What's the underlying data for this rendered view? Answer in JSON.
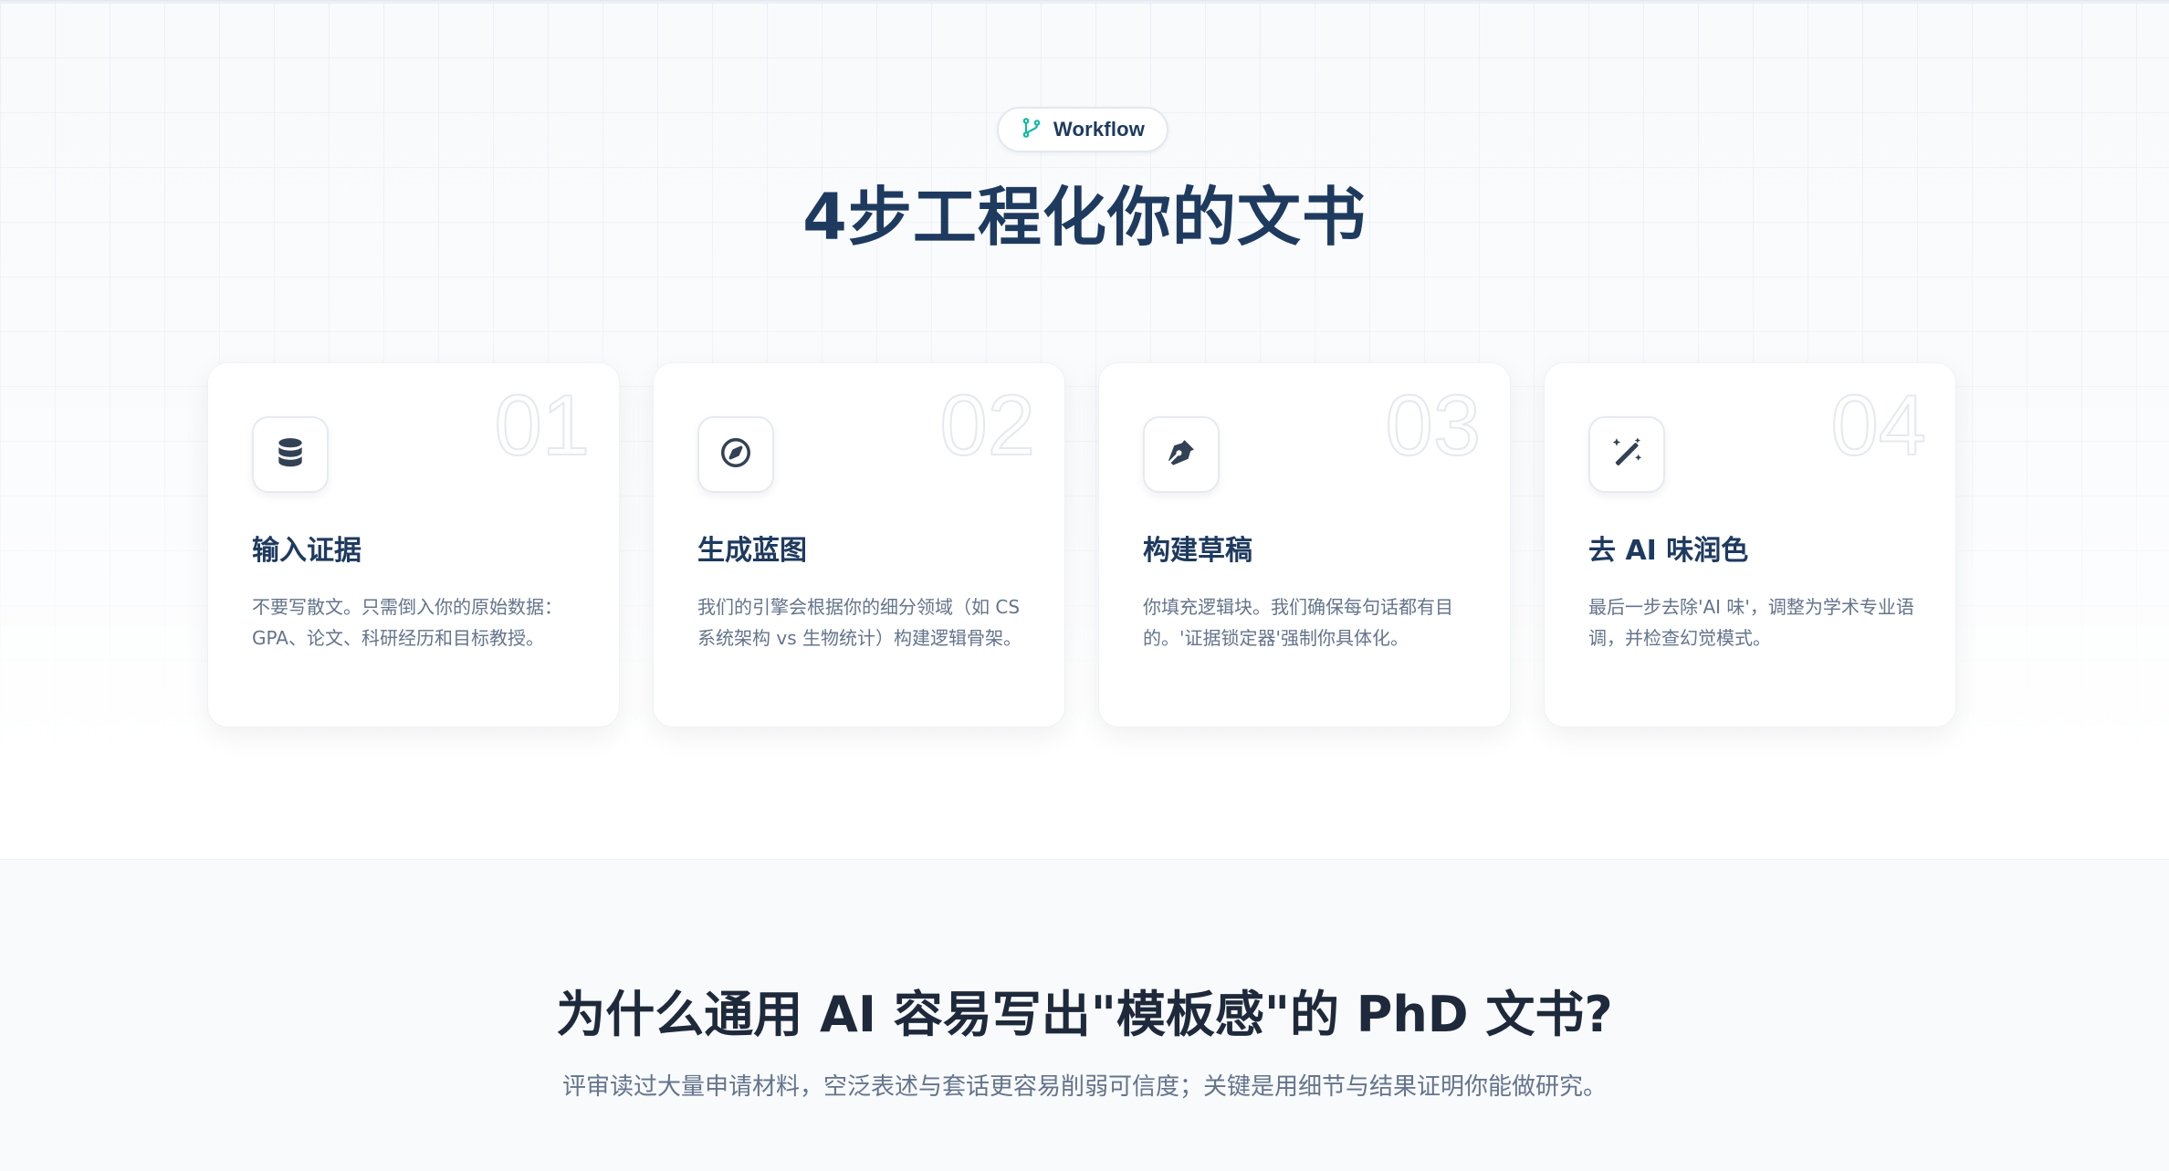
{
  "workflow": {
    "badge": {
      "label": "Workflow",
      "icon": "git-branch-icon",
      "icon_color": "#14b8a6"
    },
    "title": "4步工程化你的文书",
    "steps": [
      {
        "number": "01",
        "icon": "database-icon",
        "title": "输入证据",
        "description": "不要写散文。只需倒入你的原始数据：GPA、论文、科研经历和目标教授。"
      },
      {
        "number": "02",
        "icon": "compass-icon",
        "title": "生成蓝图",
        "description": "我们的引擎会根据你的细分领域（如 CS 系统架构 vs 生物统计）构建逻辑骨架。"
      },
      {
        "number": "03",
        "icon": "pen-nib-icon",
        "title": "构建草稿",
        "description": "你填充逻辑块。我们确保每句话都有目的。'证据锁定器'强制你具体化。"
      },
      {
        "number": "04",
        "icon": "magic-wand-icon",
        "title": "去 AI 味润色",
        "description": "最后一步去除'AI 味'，调整为学术专业语调，并检查幻觉模式。"
      }
    ]
  },
  "why": {
    "title": "为什么通用 AI 容易写出\"模板感\"的 PhD 文书?",
    "subtitle": "评审读过大量申请材料，空泛表述与套话更容易削弱可信度；关键是用细节与结果证明你能做研究。"
  },
  "colors": {
    "primary_navy": "#1e3a5f",
    "accent_teal": "#14b8a6",
    "icon_slate": "#334155",
    "muted_text": "#64748b"
  }
}
